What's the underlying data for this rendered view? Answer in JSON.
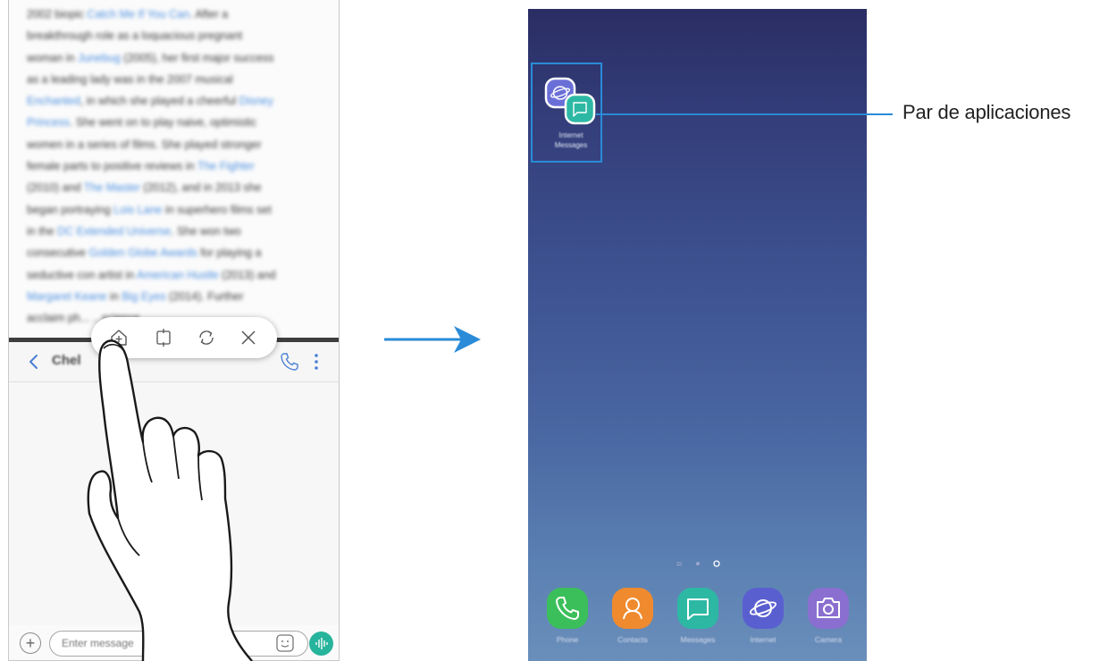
{
  "left_screen": {
    "article_lines": [
      [
        {
          "t": "2002 biopic "
        },
        {
          "t": "Catch Me If You Can",
          "link": true
        },
        {
          "t": ". After a"
        }
      ],
      [
        {
          "t": "breakthrough role as a loquacious pregnant"
        }
      ],
      [
        {
          "t": "woman in "
        },
        {
          "t": "Junebug",
          "link": true
        },
        {
          "t": " (2005), her first major success"
        }
      ],
      [
        {
          "t": "as a leading lady was in the 2007 musical"
        }
      ],
      [
        {
          "t": "Enchanted",
          "link": true
        },
        {
          "t": ", in which she played a cheerful "
        },
        {
          "t": "Disney",
          "link": true
        }
      ],
      [
        {
          "t": "Princess",
          "link": true
        },
        {
          "t": ". She went on to play naive, optimistic"
        }
      ],
      [
        {
          "t": "women in a series of films. She played stronger"
        }
      ],
      [
        {
          "t": "female parts to positive reviews in "
        },
        {
          "t": "The Fighter",
          "link": true
        }
      ],
      [
        {
          "t": "(2010) and "
        },
        {
          "t": "The Master",
          "link": true
        },
        {
          "t": " (2012), and in 2013 she"
        }
      ],
      [
        {
          "t": "began portraying "
        },
        {
          "t": "Lois Lane",
          "link": true
        },
        {
          "t": " in superhero films set"
        }
      ],
      [
        {
          "t": "in the "
        },
        {
          "t": "DC Extended Universe",
          "link": true
        },
        {
          "t": ". She won two"
        }
      ],
      [
        {
          "t": "consecutive "
        },
        {
          "t": "Golden Globe Awards",
          "link": true
        },
        {
          "t": " for playing a"
        }
      ],
      [
        {
          "t": "seductive con artist in "
        },
        {
          "t": "American Hustle",
          "link": true
        },
        {
          "t": " (2013) and"
        }
      ],
      [
        {
          "t": "Margaret Keane",
          "link": true
        },
        {
          "t": " in "
        },
        {
          "t": "Big Eyes",
          "link": true
        },
        {
          "t": " (2014). Further"
        }
      ],
      [
        {
          "t": "acclaim ph... ...science"
        }
      ]
    ],
    "messages": {
      "contact_name": "Chel",
      "input_placeholder": "Enter message"
    }
  },
  "right_screen": {
    "app_pair_label_line1": "Internet",
    "app_pair_label_line2": "Messages",
    "dock_apps": [
      {
        "label": "Phone",
        "color": "#3bbf5a",
        "icon": "phone-icon"
      },
      {
        "label": "Contacts",
        "color": "#f08a2e",
        "icon": "contacts-icon"
      },
      {
        "label": "Messages",
        "color": "#2db8a4",
        "icon": "messages-icon"
      },
      {
        "label": "Internet",
        "color": "#5a5fd0",
        "icon": "internet-icon"
      },
      {
        "label": "Camera",
        "color": "#8a6fd0",
        "icon": "camera-icon"
      }
    ]
  },
  "callout": {
    "label": "Par de aplicaciones"
  },
  "colors": {
    "callout": "#2a8bd8",
    "voice_button": "#27b49c",
    "split_bar": "#3e3e3e"
  }
}
